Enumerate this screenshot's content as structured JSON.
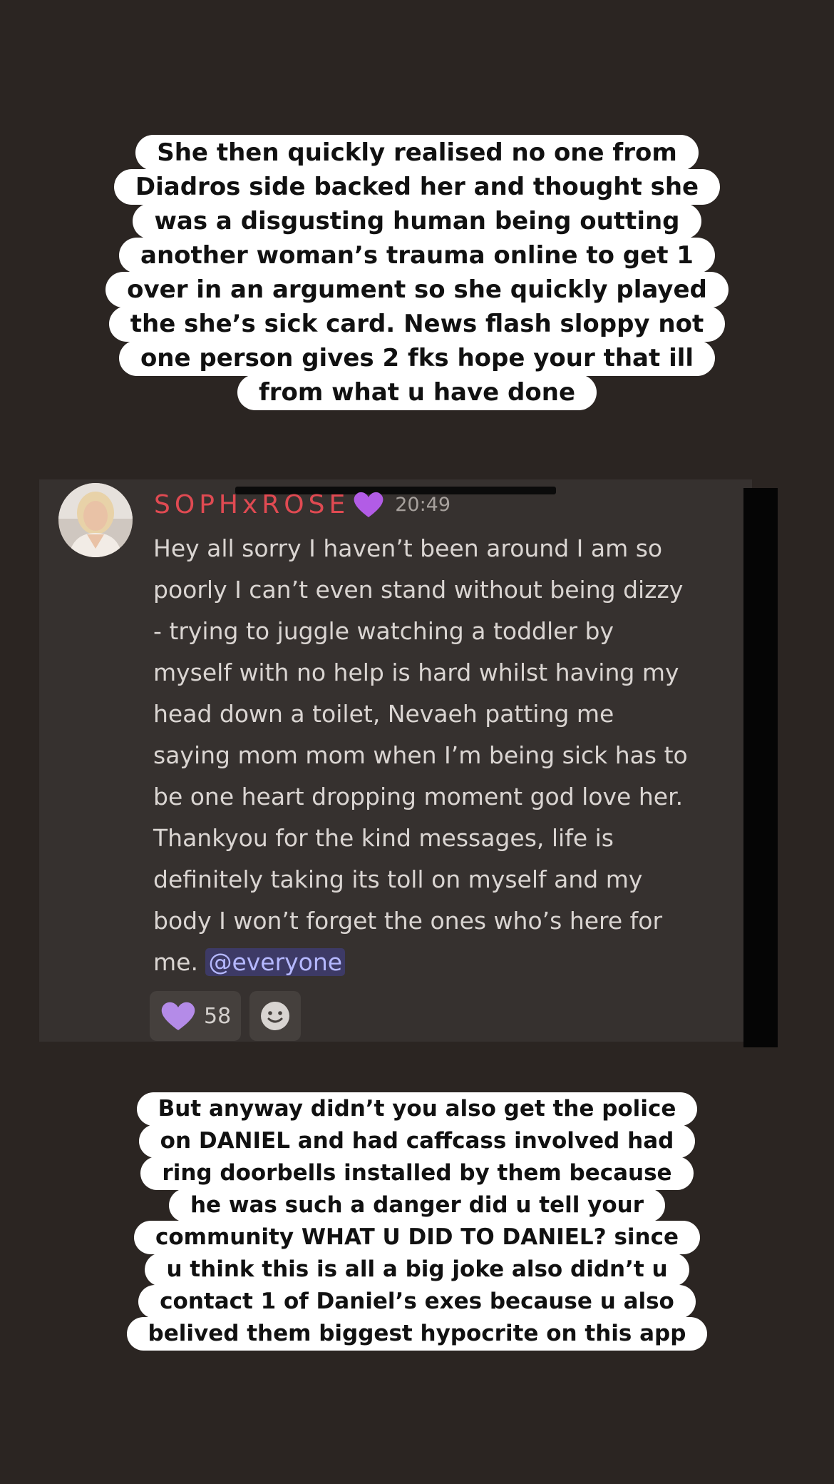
{
  "caption_top": [
    "She then quickly realised no one from",
    "Diadros side backed her and thought she",
    "was a disgusting human being outting",
    "another woman’s trauma online to get 1",
    "over in an argument so she quickly played",
    "the she’s sick card. News flash sloppy not",
    "one person gives 2 fks hope your that ill",
    "from what u have done"
  ],
  "message": {
    "username": "SOPHxROSE",
    "badge_icon": "purple-heart",
    "time": "20:49",
    "lines": [
      "Hey all sorry I haven’t been around I am so",
      "poorly I can’t even stand without being dizzy",
      "- trying to juggle watching a toddler by",
      "myself with no help is hard whilst having my",
      "head down a toilet, Nevaeh patting me",
      "saying mom mom when I’m being sick has to",
      "be one heart dropping moment god love her.",
      "Thankyou for the kind messages, life is",
      "definitely taking its toll on myself and my",
      "body I won’t forget the ones who’s here for"
    ],
    "last_line_prefix": "me.",
    "mention": "@everyone",
    "reactions": [
      {
        "icon": "purple-heart",
        "count": "58"
      }
    ],
    "add_reaction_icon": "smiley-add-reaction"
  },
  "caption_bottom": [
    "But anyway didn’t you also get the police",
    "on DANIEL and had caffcass involved had",
    "ring doorbells installed by them because",
    "he was such a danger did u tell your",
    "community WHAT U DID TO DANIEL? since",
    "u think this is all a big joke also didn’t u",
    "contact 1 of Daniel’s exes because u also",
    "belived them biggest hypocrite on this app"
  ],
  "colors": {
    "background": "#2b2522",
    "username": "#e04a52",
    "heart": "#b48be8",
    "mention_bg": "#3d3a66",
    "mention_text": "#b5b8ff"
  }
}
